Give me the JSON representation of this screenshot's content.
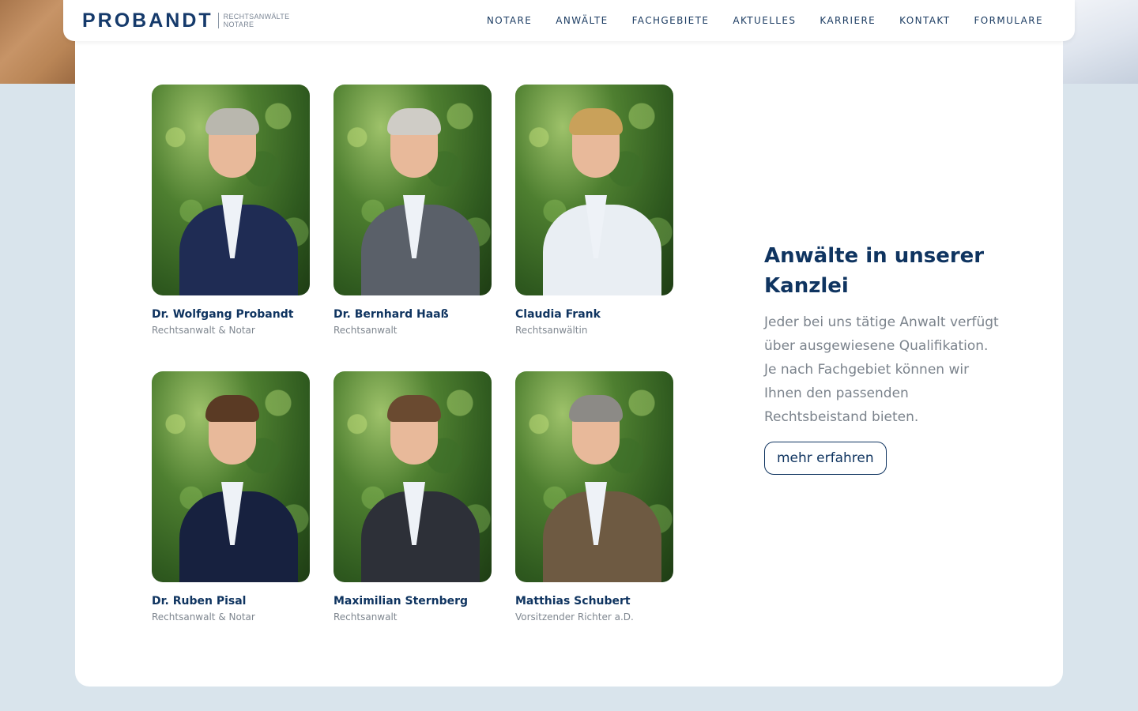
{
  "header": {
    "logo_word": "PROBANDT",
    "logo_sub_1": "RECHTSANWÄLTE",
    "logo_sub_2": "NOTARE",
    "nav": [
      "NOTARE",
      "ANWÄLTE",
      "FACHGEBIETE",
      "AKTUELLES",
      "KARRIERE",
      "KONTAKT",
      "FORMULARE"
    ]
  },
  "people": [
    {
      "name": "Dr. Wolfgang Probandt",
      "role": "Rechtsanwalt & Notar",
      "hair": "#b9b7ae",
      "suit": "#1f2c54"
    },
    {
      "name": "Dr. Bernhard Haaß",
      "role": "Rechtsanwalt",
      "hair": "#cfccc6",
      "suit": "#5a6069"
    },
    {
      "name": "Claudia Frank",
      "role": "Rechtsanwältin",
      "hair": "#c9a15a",
      "suit": "#e9eef3"
    },
    {
      "name": "Dr. Ruben Pisal",
      "role": "Rechtsanwalt & Notar",
      "hair": "#5a3a24",
      "suit": "#17213f"
    },
    {
      "name": "Maximilian Sternberg",
      "role": "Rechtsanwalt",
      "hair": "#6a4a30",
      "suit": "#2d3038"
    },
    {
      "name": "Matthias Schubert",
      "role": "Vorsitzender Richter a.D.",
      "hair": "#8c8a86",
      "suit": "#6e5a42"
    }
  ],
  "side": {
    "heading": "Anwälte in unserer Kanzlei",
    "text": "Jeder bei uns tätige Anwalt verfügt über ausgewiesene Qualifikation. Je nach Fachgebiet können wir Ihnen den passenden Rechtsbeistand bieten.",
    "button": "mehr erfahren"
  },
  "colors": {
    "brand": "#0f3460",
    "background": "#d9e4ec",
    "muted_text": "#7b838c"
  }
}
